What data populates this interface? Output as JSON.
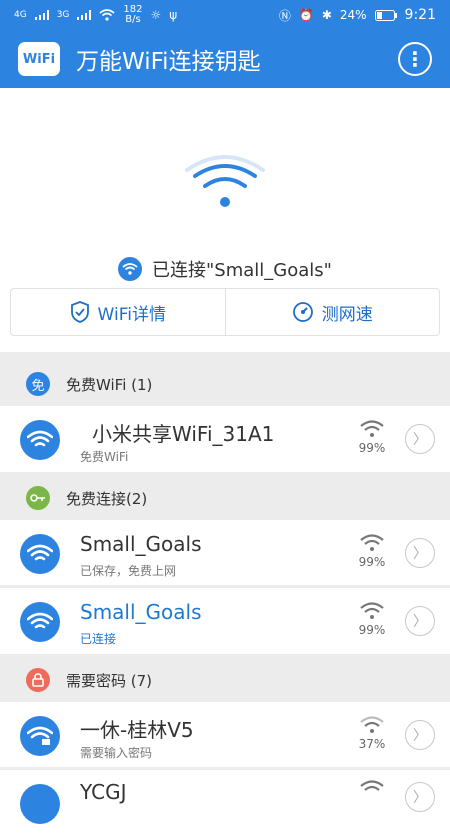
{
  "status_bar": {
    "net_speed_value": "182",
    "net_speed_unit": "B/s",
    "net_4g": "4G",
    "net_3g": "3G",
    "battery": "24%",
    "time": "9:21"
  },
  "app": {
    "logo_text": "WiFi",
    "title": "万能WiFi连接钥匙"
  },
  "hero": {
    "connected_text": "已连接\"Small_Goals\"",
    "wifi_detail_label": "WiFi详情",
    "speed_test_label": "测网速"
  },
  "sections": {
    "free_wifi": {
      "badge": "免",
      "label": "免费WiFi (1)"
    },
    "free_connect": {
      "label": "免费连接(2)"
    },
    "need_password": {
      "label": "需要密码 (7)"
    }
  },
  "networks": [
    {
      "name": "小米共享WiFi_31A1",
      "status": "免费WiFi",
      "signal": "99%"
    },
    {
      "name": "Small_Goals",
      "status": "已保存，免费上网",
      "signal": "99%"
    },
    {
      "name": "Small_Goals",
      "status": "已连接",
      "signal": "99%"
    },
    {
      "name": "一休-桂林V5",
      "status": "需要输入密码",
      "signal": "37%"
    },
    {
      "name": "YCGJ",
      "status": "",
      "signal": ""
    }
  ],
  "colors": {
    "brand": "#2d83e0",
    "connected_text": "#1f78d1",
    "free_connect_badge": "#7ab648",
    "password_badge": "#ef6b5b"
  },
  "icons": {
    "menu": "more-vertical-icon",
    "wifi": "wifi-icon",
    "shield": "shield-check-icon",
    "speed": "speedometer-icon",
    "key": "key-icon",
    "lock": "lock-icon",
    "chevron": "chevron-right-icon"
  }
}
